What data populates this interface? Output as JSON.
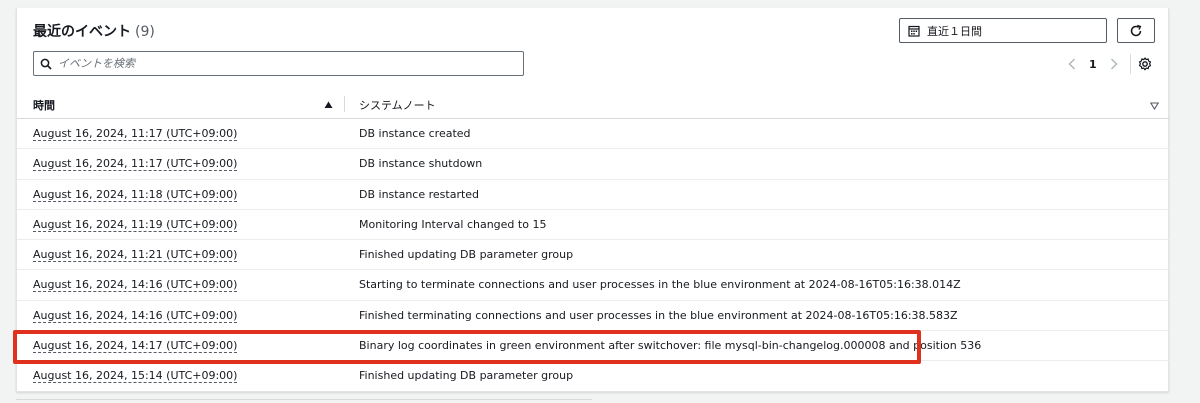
{
  "header": {
    "title": "最近のイベント",
    "count": "(9)"
  },
  "toolbar": {
    "date_range_label": "直近１日間",
    "search_placeholder": "イベントを検索",
    "page_number": "1"
  },
  "table": {
    "columns": {
      "time": "時間",
      "system_note": "システムノート"
    },
    "rows": [
      {
        "time": "August 16, 2024, 11:17 (UTC+09:00)",
        "note": "DB instance created"
      },
      {
        "time": "August 16, 2024, 11:17 (UTC+09:00)",
        "note": "DB instance shutdown"
      },
      {
        "time": "August 16, 2024, 11:18 (UTC+09:00)",
        "note": "DB instance restarted"
      },
      {
        "time": "August 16, 2024, 11:19 (UTC+09:00)",
        "note": "Monitoring Interval changed to 15"
      },
      {
        "time": "August 16, 2024, 11:21 (UTC+09:00)",
        "note": "Finished updating DB parameter group"
      },
      {
        "time": "August 16, 2024, 14:16 (UTC+09:00)",
        "note": "Starting to terminate connections and user processes in the blue environment at 2024-08-16T05:16:38.014Z"
      },
      {
        "time": "August 16, 2024, 14:16 (UTC+09:00)",
        "note": "Finished terminating connections and user processes in the blue environment at 2024-08-16T05:16:38.583Z"
      },
      {
        "time": "August 16, 2024, 14:17 (UTC+09:00)",
        "note": "Binary log coordinates in green environment after switchover: file mysql-bin-changelog.000008 and position 536"
      },
      {
        "time": "August 16, 2024, 15:14 (UTC+09:00)",
        "note": "Finished updating DB parameter group"
      }
    ]
  },
  "highlight_color": "#e0301e",
  "icons": [
    "calendar-icon",
    "refresh-icon",
    "search-icon",
    "chevron-left-icon",
    "chevron-right-icon",
    "gear-icon",
    "sort-ascending-icon",
    "sort-descending-icon"
  ]
}
